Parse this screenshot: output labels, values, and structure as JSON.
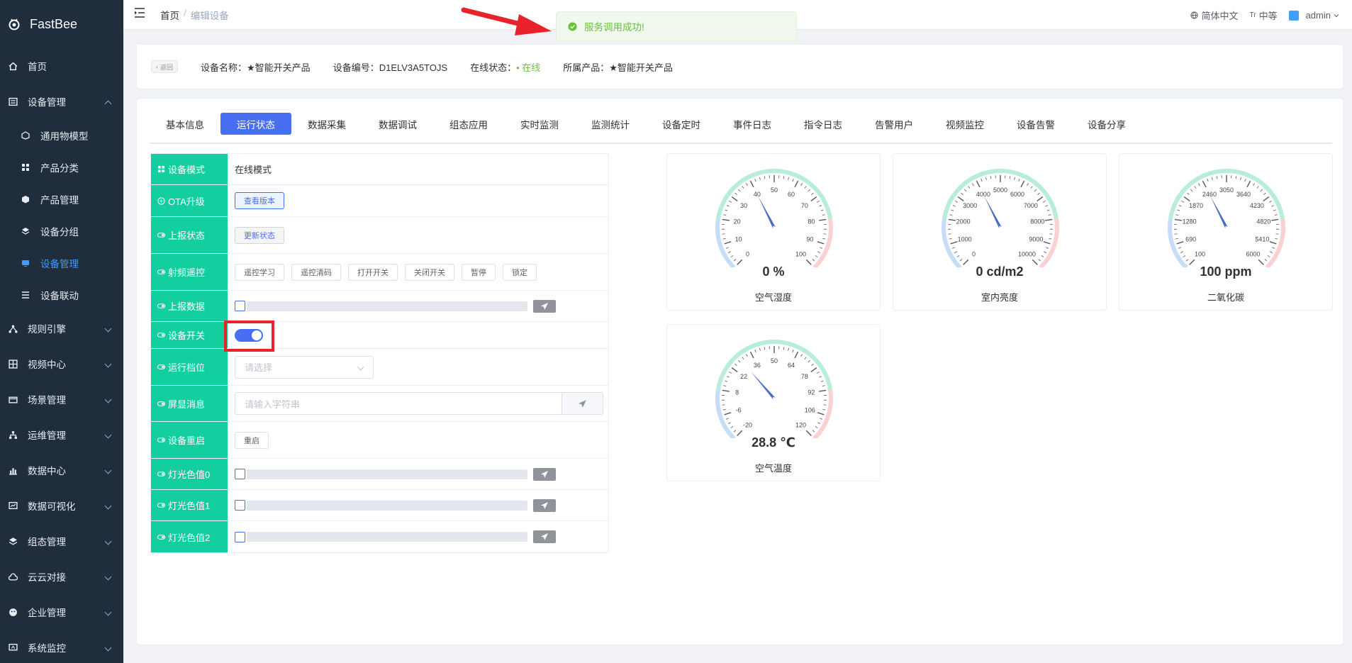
{
  "app": {
    "name": "FastBee"
  },
  "sidebar": {
    "items": [
      {
        "label": "首页",
        "icon": "home-icon"
      },
      {
        "label": "设备管理",
        "icon": "device-icon",
        "expanded": true,
        "children": [
          {
            "label": "通用物模型"
          },
          {
            "label": "产品分类"
          },
          {
            "label": "产品管理"
          },
          {
            "label": "设备分组"
          },
          {
            "label": "设备管理",
            "active": true
          },
          {
            "label": "设备联动"
          }
        ]
      },
      {
        "label": "规则引擎"
      },
      {
        "label": "视频中心"
      },
      {
        "label": "场景管理"
      },
      {
        "label": "运维管理"
      },
      {
        "label": "数据中心"
      },
      {
        "label": "数据可视化"
      },
      {
        "label": "组态管理"
      },
      {
        "label": "云云对接"
      },
      {
        "label": "企业管理"
      },
      {
        "label": "系统监控"
      }
    ]
  },
  "navbar": {
    "breadcrumb_home": "首页",
    "breadcrumb_sep": "/",
    "breadcrumb_current": "编辑设备",
    "language": "简体中文",
    "font_size": "中等",
    "user": "admin"
  },
  "toast": {
    "message": "服务调用成功!"
  },
  "device_info": {
    "back_label": "返回",
    "name_label": "设备名称：",
    "name_value": "★智能开关产品",
    "serial_label": "设备编号：",
    "serial_value": "D1ELV3A5TOJS",
    "status_label": "在线状态：",
    "status_value": "在线",
    "product_label": "所属产品：",
    "product_value": "★智能开关产品"
  },
  "tabs": [
    "基本信息",
    "运行状态",
    "数据采集",
    "数据调试",
    "组态应用",
    "实时监测",
    "监测统计",
    "设备定时",
    "事件日志",
    "指令日志",
    "告警用户",
    "视频监控",
    "设备告警",
    "设备分享"
  ],
  "active_tab": "运行状态",
  "controls": {
    "mode_label": "设备模式",
    "mode_value": "在线模式",
    "ota_label": "OTA升级",
    "ota_button": "查看版本",
    "report_label": "上报状态",
    "report_button": "更新状态",
    "rf_label": "射频遥控",
    "rf_buttons": [
      "遥控学习",
      "遥控清码",
      "打开开关",
      "关闭开关",
      "暂停",
      "锁定"
    ],
    "report_data_label": "上报数据",
    "switch_label": "设备开关",
    "switch_on": true,
    "gear_label": "运行档位",
    "gear_placeholder": "请选择",
    "screen_label": "屏显消息",
    "screen_placeholder": "请输入字符串",
    "restart_label": "设备重启",
    "restart_button": "重启",
    "light0_label": "灯光色值0",
    "light1_label": "灯光色值1",
    "light2_label": "灯光色值2"
  },
  "gauges": [
    {
      "name": "空气湿度",
      "value_text": "0 %",
      "min": 0,
      "max": 100,
      "value": 40,
      "ticks": [
        "0",
        "10",
        "20",
        "30",
        "40",
        "50",
        "60",
        "70",
        "80",
        "90",
        "100"
      ]
    },
    {
      "name": "室内亮度",
      "value_text": "0 cd/m2",
      "min": 0,
      "max": 10000,
      "value": 4000,
      "ticks": [
        "0",
        "1000",
        "2000",
        "3000",
        "4000",
        "5000",
        "6000",
        "7000",
        "8000",
        "9000",
        "10000"
      ]
    },
    {
      "name": "二氧化碳",
      "value_text": "100 ppm",
      "min": 100,
      "max": 6000,
      "value": 2460,
      "ticks": [
        "100",
        "690",
        "1280",
        "1870",
        "2460",
        "3050",
        "3640",
        "4230",
        "4820",
        "5410",
        "6000"
      ]
    },
    {
      "name": "空气温度",
      "value_text": "28.8 ℃",
      "min": -20,
      "max": 120,
      "value": 28.8,
      "ticks": [
        "-20",
        "-6",
        "8",
        "22",
        "36",
        "50",
        "64",
        "78",
        "92",
        "106",
        "120"
      ]
    }
  ]
}
